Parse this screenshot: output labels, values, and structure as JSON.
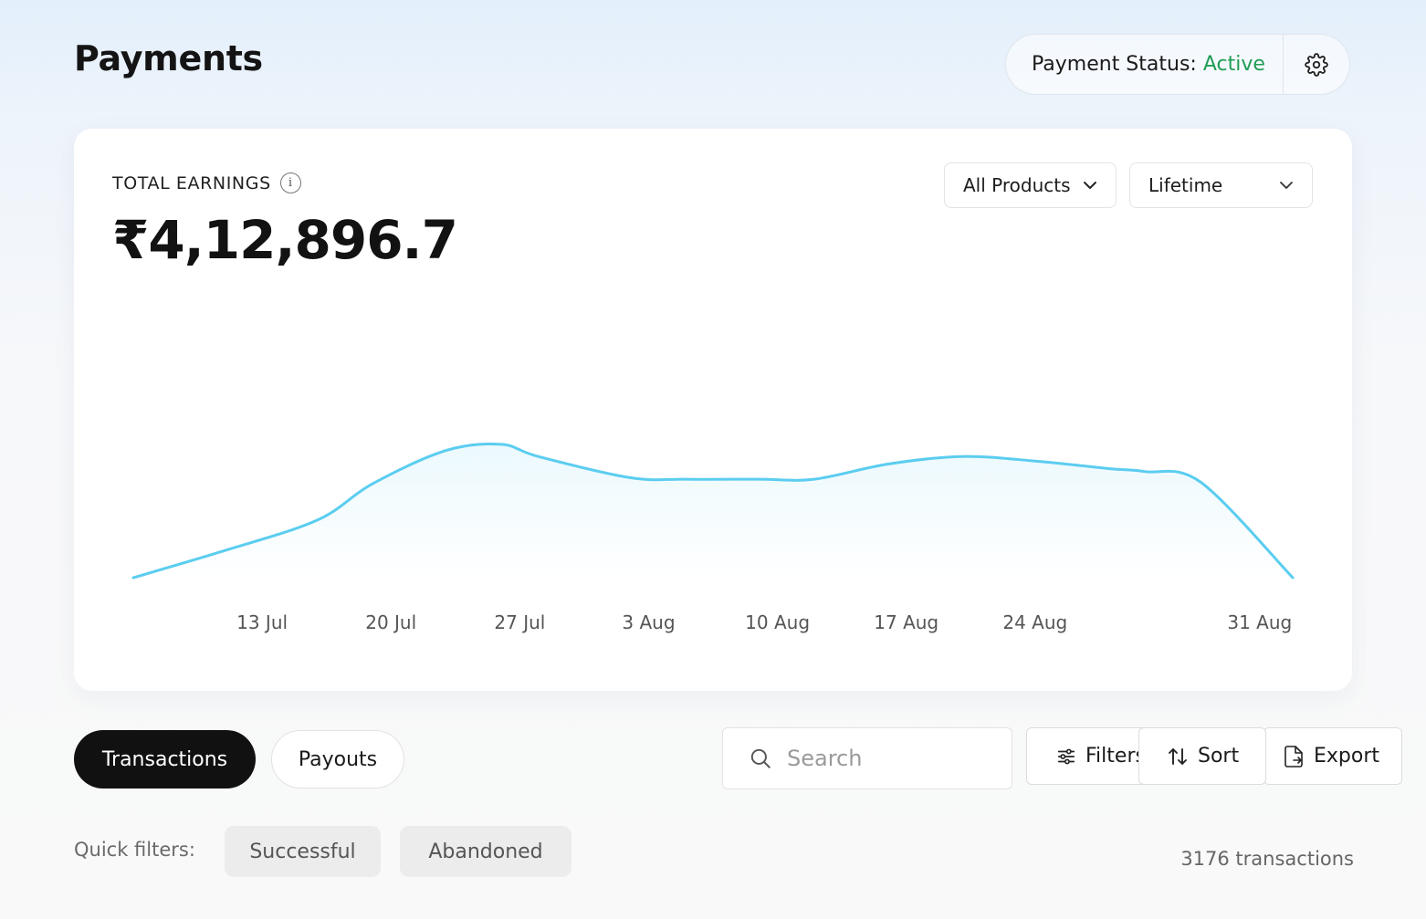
{
  "header": {
    "title": "Payments",
    "status_label": "Payment Status:",
    "status_value": "Active",
    "status_color": "#1f9d55",
    "settings_icon": "gear-icon"
  },
  "earnings": {
    "label": "TOTAL EARNINGS",
    "info_icon": "info-icon",
    "value": "₹4,12,896.7",
    "filters": {
      "product": "All Products",
      "range": "Lifetime"
    }
  },
  "chart_data": {
    "type": "area",
    "line_color": "#5bcdf0",
    "x_tick_labels": [
      "13 Jul",
      "20 Jul",
      "27 Jul",
      "3 Aug",
      "10 Aug",
      "17 Aug",
      "24 Aug",
      "31 Aug"
    ],
    "x_days": [
      0,
      5,
      10,
      13,
      17,
      20,
      22,
      27,
      30,
      34,
      37,
      41,
      45,
      49,
      53,
      55,
      58,
      63
    ],
    "values": [
      0,
      18,
      38,
      62,
      84,
      88,
      80,
      66,
      65,
      65,
      65,
      75,
      80,
      77,
      72,
      70,
      63,
      0
    ],
    "y_range": [
      0,
      100
    ],
    "grid": false,
    "legend": "none"
  },
  "tabs": [
    {
      "label": "Transactions",
      "active": true
    },
    {
      "label": "Payouts",
      "active": false
    }
  ],
  "search": {
    "placeholder": "Search"
  },
  "actions": {
    "filter_label": "Filters",
    "sort_label": "Sort",
    "export_label": "Export"
  },
  "quick_filters": {
    "label": "Quick filters:",
    "chips": [
      "Successful",
      "Abandoned"
    ]
  },
  "transactions_count": "3176 transactions"
}
